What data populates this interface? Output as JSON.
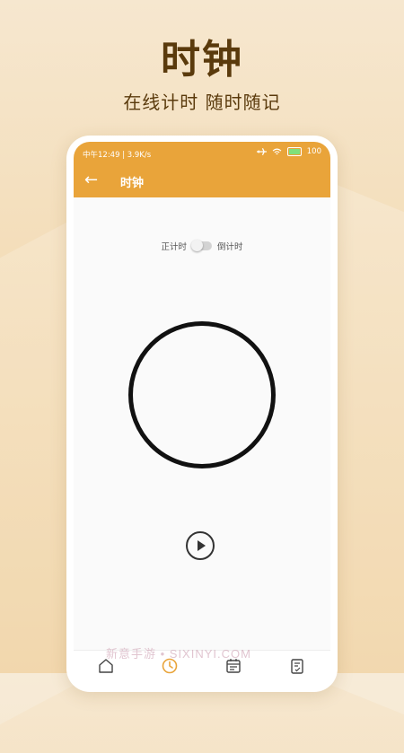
{
  "promo": {
    "headline": "时钟",
    "subline": "在线计时 随时随记"
  },
  "status_bar": {
    "left_text": "中午12:49 | 3.9K/s",
    "battery_text": "100"
  },
  "app_bar": {
    "back_icon": "←",
    "title": "时钟"
  },
  "mode_switch": {
    "left_label": "正计时",
    "right_label": "倒计时",
    "state": "off"
  },
  "controls": {
    "play_icon": "play-icon"
  },
  "bottom_nav": {
    "items": [
      {
        "icon": "home-icon"
      },
      {
        "icon": "clock-icon",
        "active": true
      },
      {
        "icon": "calendar-icon"
      },
      {
        "icon": "notes-icon"
      }
    ]
  },
  "watermark": "新意手游 • SIXINYI.COM",
  "colors": {
    "accent": "#e9a43a",
    "headline": "#5a3a0c",
    "active_nav": "#e9a43a"
  }
}
